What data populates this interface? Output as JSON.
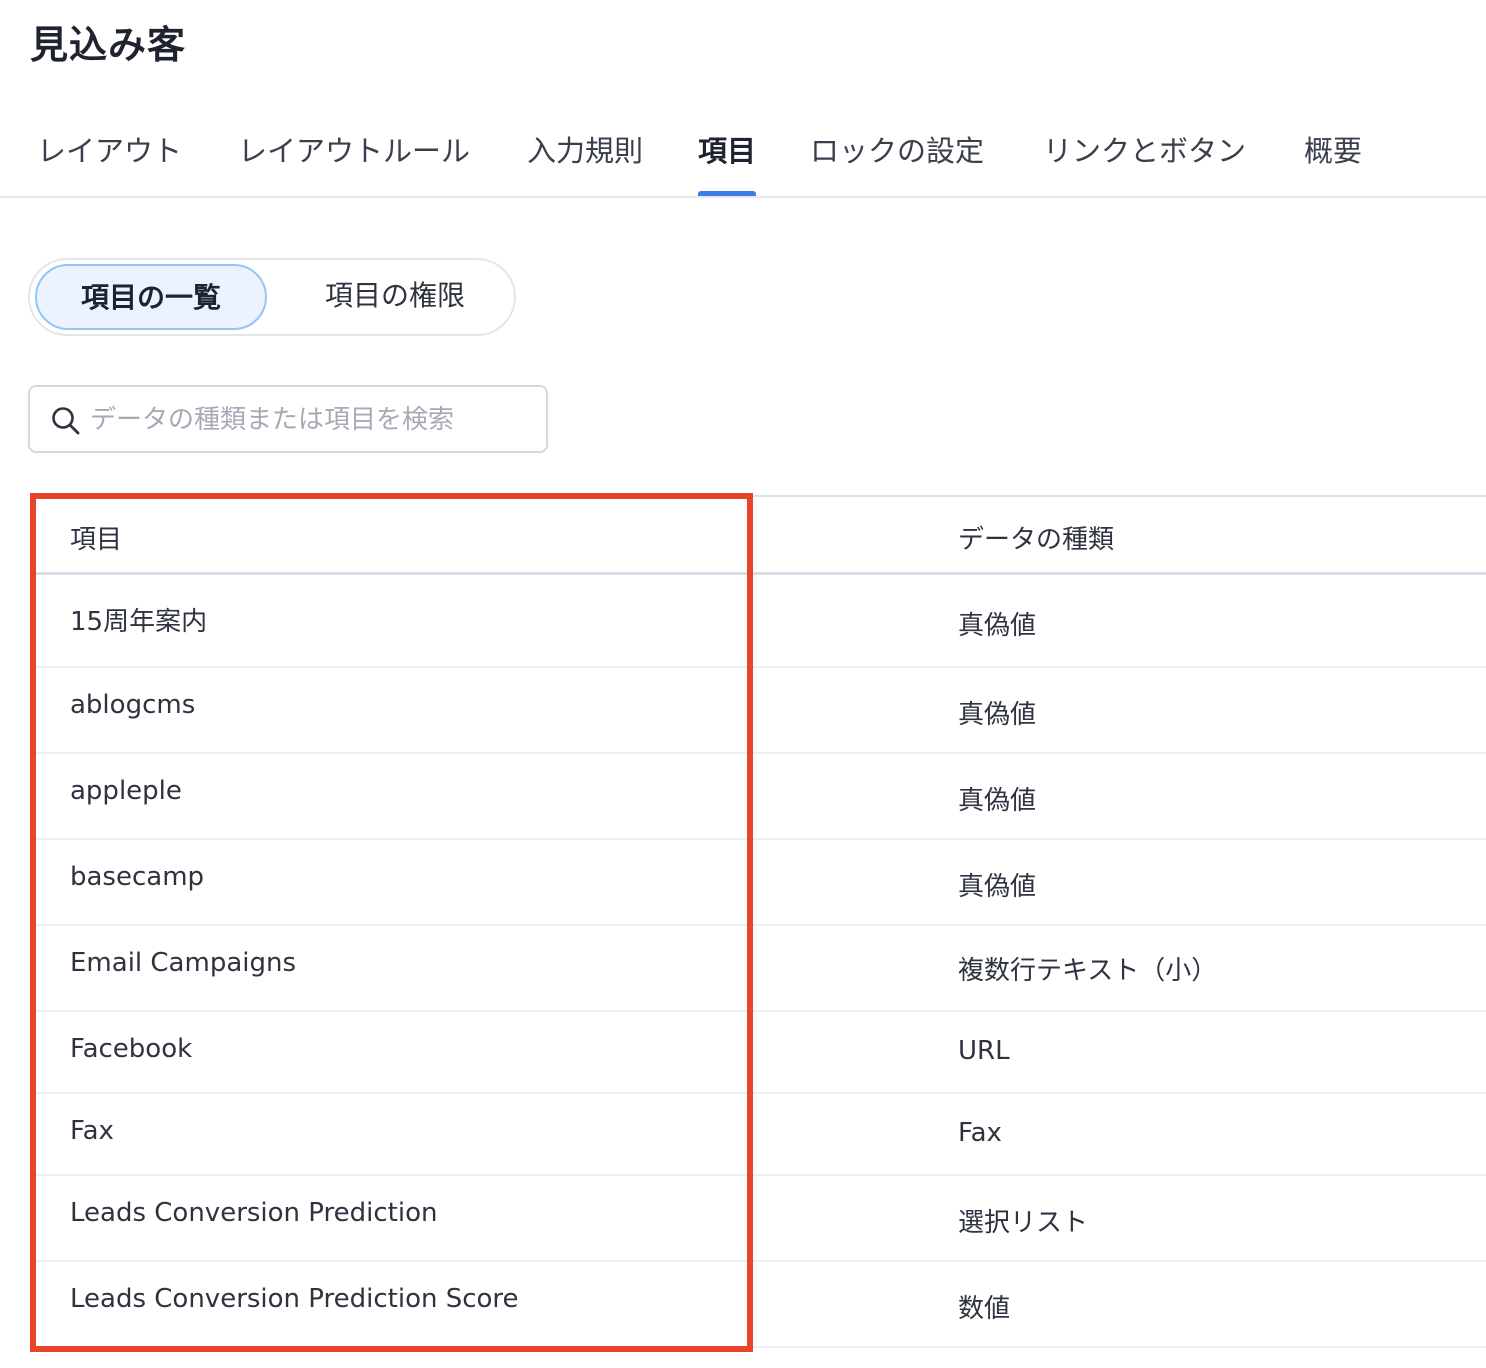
{
  "page_title": "見込み客",
  "tabs": [
    {
      "label": "レイアウト"
    },
    {
      "label": "レイアウトルール"
    },
    {
      "label": "入力規則"
    },
    {
      "label": "項目"
    },
    {
      "label": "ロックの設定"
    },
    {
      "label": "リンクとボタン"
    },
    {
      "label": "概要"
    }
  ],
  "active_tab": "項目",
  "view_toggle": {
    "active_label": "項目の一覧",
    "inactive_label": "項目の権限"
  },
  "search": {
    "placeholder": "データの種類または項目を検索",
    "value": ""
  },
  "table": {
    "headers": {
      "field": "項目",
      "type": "データの種類"
    },
    "rows": [
      {
        "field": "15周年案内",
        "type": "真偽値"
      },
      {
        "field": "ablogcms",
        "type": "真偽値"
      },
      {
        "field": "appleple",
        "type": "真偽値"
      },
      {
        "field": "basecamp",
        "type": "真偽値"
      },
      {
        "field": "Email Campaigns",
        "type": "複数行テキスト（小）"
      },
      {
        "field": "Facebook",
        "type": "URL"
      },
      {
        "field": "Fax",
        "type": "Fax"
      },
      {
        "field": "Leads Conversion Prediction",
        "type": "選択リスト"
      },
      {
        "field": "Leads Conversion Prediction Score",
        "type": "数値"
      }
    ]
  },
  "colors": {
    "accent": "#3b7de6",
    "highlight": "#e8442b",
    "toggle_active_bg": "#eaf3fe"
  }
}
